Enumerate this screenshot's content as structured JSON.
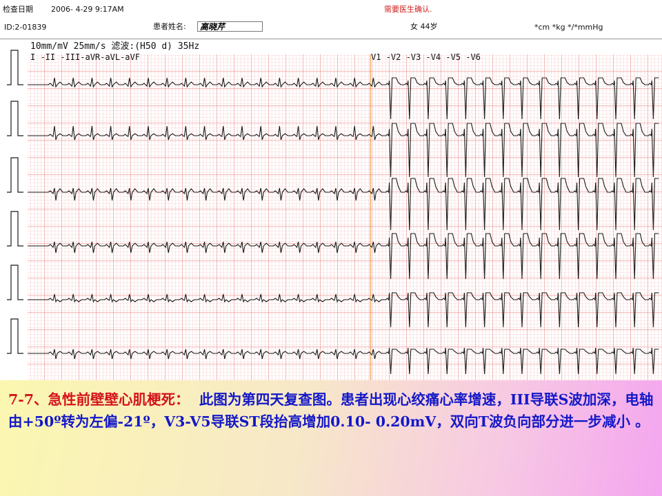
{
  "header": {
    "date_label": "检查日期",
    "date_value": "2006- 4-29  9:17AM",
    "notice": "需要医生确认.",
    "id_value": "ID:2-01839",
    "name_label": "患者姓名:",
    "name_value": "高晓芹",
    "sex_age": "女  44岁",
    "units": "*cm  *kg  */*mmHg"
  },
  "ecg": {
    "settings_line": "10mm/mV 25mm/s 滤波:(H50 d) 35Hz",
    "limb_leads_label": "I  -II -III-aVR-aVL-aVF",
    "chest_leads_label": "V1 -V2 -V3 -V4 -V5 -V6",
    "rows": [
      {
        "limb": "I",
        "chest": "V1"
      },
      {
        "limb": "II",
        "chest": "V2"
      },
      {
        "limb": "III",
        "chest": "V3"
      },
      {
        "limb": "aVR",
        "chest": "V4"
      },
      {
        "limb": "aVL",
        "chest": "V5"
      },
      {
        "limb": "aVF",
        "chest": "V6"
      }
    ],
    "colors": {
      "grid_minor": "#f3b5b5",
      "grid_major": "#e77a7a",
      "trace": "#1a1a1a",
      "divider": "#e08a20"
    }
  },
  "caption": {
    "title": "7-7、急性前壁壁心肌梗死：",
    "body": "此图为第四天复查图。患者出现心绞痛心率增速，III导联S波加深，电轴由+50º转为左偏-21º，V3-V5导联ST段抬高增加0.10- 0.20mV，双向T波负向部分进一步减小 。"
  }
}
